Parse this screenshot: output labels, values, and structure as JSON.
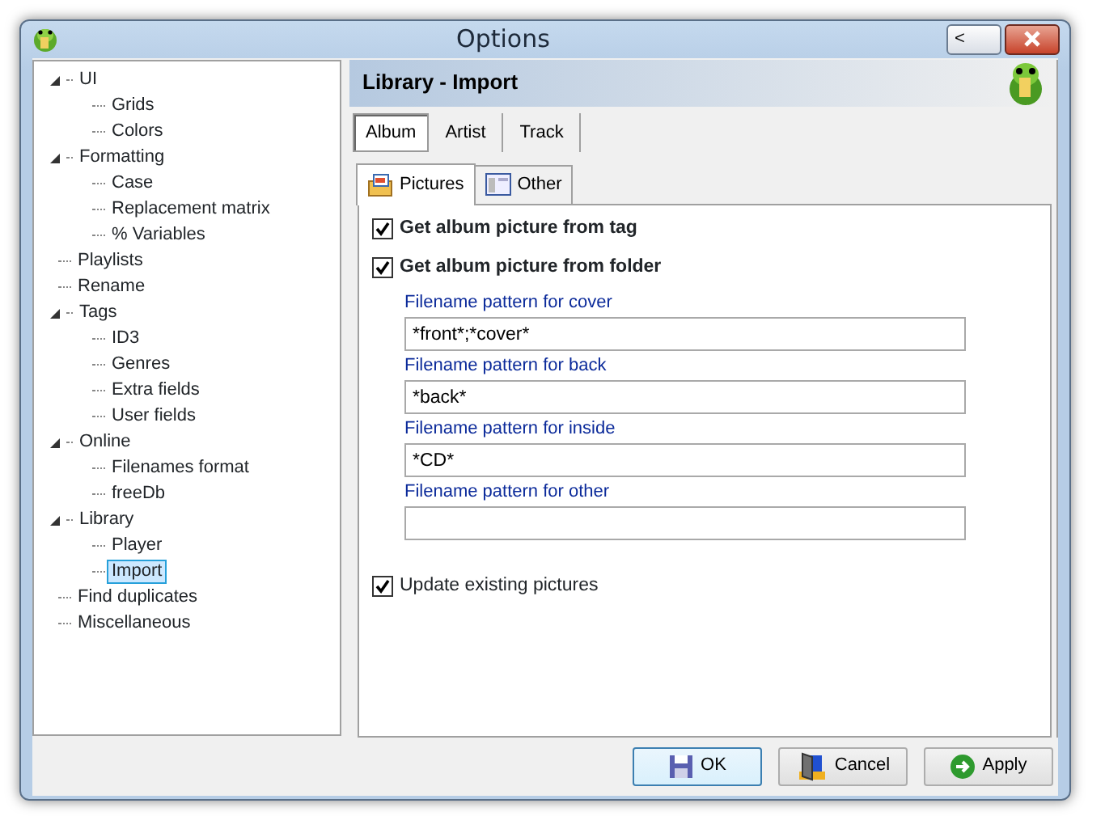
{
  "window": {
    "title": "Options",
    "back_button": "<"
  },
  "tree": [
    {
      "label": "UI",
      "expanded": true,
      "selected": false,
      "children": [
        {
          "label": "Grids",
          "selected": false
        },
        {
          "label": "Colors",
          "selected": false
        }
      ]
    },
    {
      "label": "Formatting",
      "expanded": true,
      "selected": false,
      "children": [
        {
          "label": "Case",
          "selected": false
        },
        {
          "label": "Replacement matrix",
          "selected": false
        },
        {
          "label": "% Variables",
          "selected": false
        }
      ]
    },
    {
      "label": "Playlists",
      "selected": false
    },
    {
      "label": "Rename",
      "selected": false
    },
    {
      "label": "Tags",
      "expanded": true,
      "selected": false,
      "children": [
        {
          "label": "ID3",
          "selected": false
        },
        {
          "label": "Genres",
          "selected": false
        },
        {
          "label": "Extra fields",
          "selected": false
        },
        {
          "label": "User fields",
          "selected": false
        }
      ]
    },
    {
      "label": "Online",
      "expanded": true,
      "selected": false,
      "children": [
        {
          "label": "Filenames format",
          "selected": false
        },
        {
          "label": "freeDb",
          "selected": false
        }
      ]
    },
    {
      "label": "Library",
      "expanded": true,
      "selected": false,
      "children": [
        {
          "label": "Player",
          "selected": false
        },
        {
          "label": "Import",
          "selected": true
        }
      ]
    },
    {
      "label": "Find duplicates",
      "selected": false
    },
    {
      "label": "Miscellaneous",
      "selected": false
    }
  ],
  "header": {
    "title": "Library - Import"
  },
  "tabs": [
    {
      "label": "Album",
      "selected": true
    },
    {
      "label": "Artist",
      "selected": false
    },
    {
      "label": "Track",
      "selected": false
    }
  ],
  "subtabs": [
    {
      "label": "Pictures",
      "selected": true
    },
    {
      "label": "Other",
      "selected": false
    }
  ],
  "options": [
    {
      "kind": "checkbox",
      "label": "Get album picture from tag",
      "checked": true,
      "bold": true
    },
    {
      "kind": "checkbox",
      "label": "Get album picture from folder",
      "checked": true,
      "bold": true
    },
    {
      "kind": "field",
      "label": "Filename pattern for cover",
      "value": "*front*;*cover*"
    },
    {
      "kind": "field",
      "label": "Filename pattern for back",
      "value": "*back*"
    },
    {
      "kind": "field",
      "label": "Filename pattern for inside",
      "value": "*CD*"
    },
    {
      "kind": "field",
      "label": "Filename pattern for other"
    },
    {
      "kind": "checkbox",
      "label": "Update existing pictures",
      "checked": true,
      "bold": false
    }
  ],
  "buttons": [
    {
      "kind": "ok",
      "label": "OK",
      "default": true
    },
    {
      "kind": "cancel",
      "label": "Cancel",
      "default": false
    },
    {
      "kind": "apply",
      "label": "Apply",
      "default": false
    }
  ]
}
